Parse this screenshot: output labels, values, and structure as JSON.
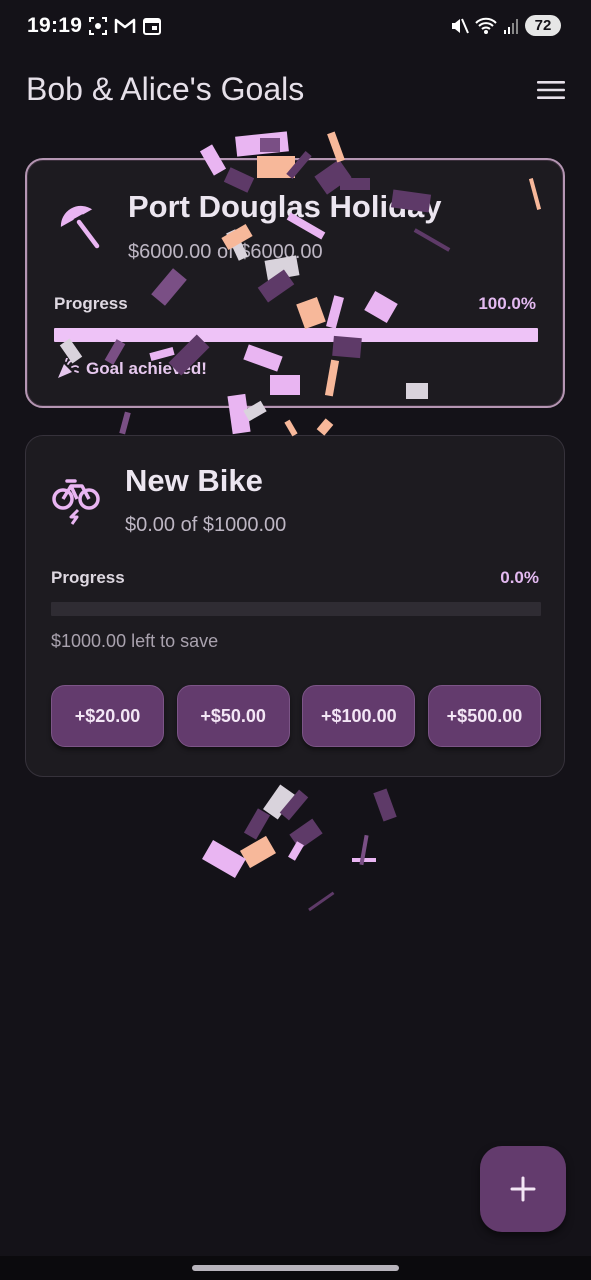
{
  "status_bar": {
    "time": "19:19",
    "battery": "72"
  },
  "app_bar": {
    "title": "Bob & Alice's Goals",
    "menu_icon": "hamburger-menu-icon"
  },
  "goals": [
    {
      "title": "Port Douglas Holiday",
      "icon": "beach-umbrella-icon",
      "amount_text": "$6000.00 of $6000.00",
      "progress_label": "Progress",
      "progress_percent_text": "100.0%",
      "progress_fraction": 1.0,
      "achieved_text": "Goal achieved!"
    },
    {
      "title": "New Bike",
      "icon": "electric-bike-icon",
      "amount_text": "$0.00 of $1000.00",
      "progress_label": "Progress",
      "progress_percent_text": "0.0%",
      "progress_fraction": 0.0,
      "left_to_save_text": "$1000.00 left to save",
      "quick_add_buttons": [
        "+$20.00",
        "+$50.00",
        "+$100.00",
        "+$500.00"
      ]
    }
  ],
  "fab": {
    "icon": "plus-icon"
  },
  "colors": {
    "background": "#141218",
    "card": "#1d1b20",
    "accent": "#eec3f7",
    "button": "#633b6d",
    "confetti": [
      "#e9b5f2",
      "#f7b89a",
      "#5e3a68",
      "#d9d3dc",
      "#7a4f85"
    ]
  }
}
